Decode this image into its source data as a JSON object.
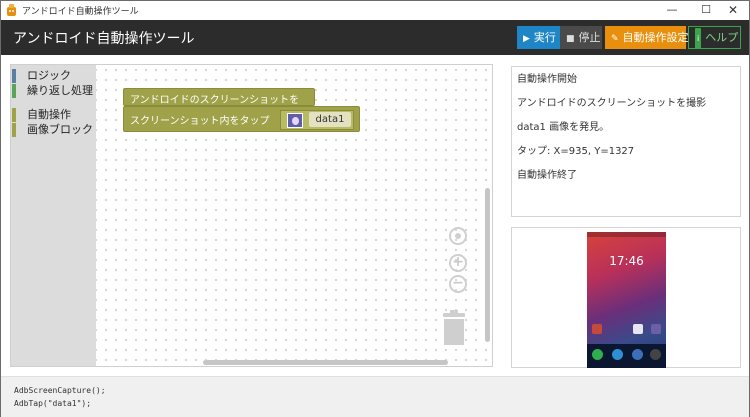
{
  "window": {
    "title": "アンドロイド自動操作ツール",
    "min_glyph": "—",
    "max_glyph": "☐",
    "close_glyph": "✕"
  },
  "header": {
    "title": "アンドロイド自動操作ツール",
    "run_label": "実行",
    "run_icon": "▶",
    "stop_label": "停止",
    "stop_icon": "■",
    "setting_label": "自動操作設定",
    "setting_icon": "✎",
    "help_label": "ヘルプ",
    "help_icon": "i"
  },
  "toolbox": {
    "categories": [
      {
        "label": "ロジック",
        "color": "#5b80a5"
      },
      {
        "label": "繰り返し処理",
        "color": "#5ba55b"
      },
      {
        "label": "自動操作",
        "color": "#a0a24a"
      },
      {
        "label": "画像ブロック",
        "color": "#a0a24a"
      }
    ]
  },
  "blocks": {
    "screenshot_label": "アンドロイドのスクリーンショットを撮影",
    "tap_label": "スクリーンショット内をタップ",
    "image_label": "data1"
  },
  "log": {
    "lines": [
      "自動操作開始",
      "アンドロイドのスクリーンショットを撮影",
      "data1 画像を発見。",
      "タップ: X=935, Y=1327",
      "自動操作終了"
    ]
  },
  "phone": {
    "time": "17:46"
  },
  "code": {
    "lines": [
      "AdbScreenCapture();",
      "AdbTap(\"data1\");"
    ]
  },
  "colors": {
    "header_bg": "#2c2c2c",
    "run": "#1e86c7",
    "stop": "#4a4a4a",
    "setting": "#e8900d",
    "help": "#3aa54a",
    "block": "#a0a24a"
  }
}
